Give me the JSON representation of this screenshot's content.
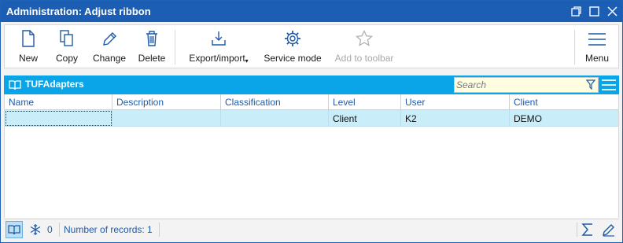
{
  "window": {
    "title": "Administration: Adjust ribbon",
    "controls": [
      "restore-icon",
      "maximize-icon",
      "close-icon"
    ]
  },
  "toolbar": {
    "new_label": "New",
    "copy_label": "Copy",
    "change_label": "Change",
    "delete_label": "Delete",
    "export_label": "Export/import",
    "service_label": "Service mode",
    "add_toolbar_label": "Add to toolbar",
    "menu_label": "Menu"
  },
  "grid": {
    "title": "TUFAdapters",
    "search_placeholder": "Search",
    "columns": [
      "Name",
      "Description",
      "Classification",
      "Level",
      "User",
      "Client"
    ],
    "rows": [
      {
        "name": "",
        "description": "",
        "classification": "",
        "level": "Client",
        "user": "K2",
        "client": "DEMO"
      }
    ]
  },
  "status": {
    "count": "0",
    "records": "Number of records: 1"
  },
  "colors": {
    "titlebar": "#1c5eb3",
    "grid_header": "#0aa5e8",
    "selected_row": "#c9eef9",
    "link_text": "#1f5aa8"
  }
}
